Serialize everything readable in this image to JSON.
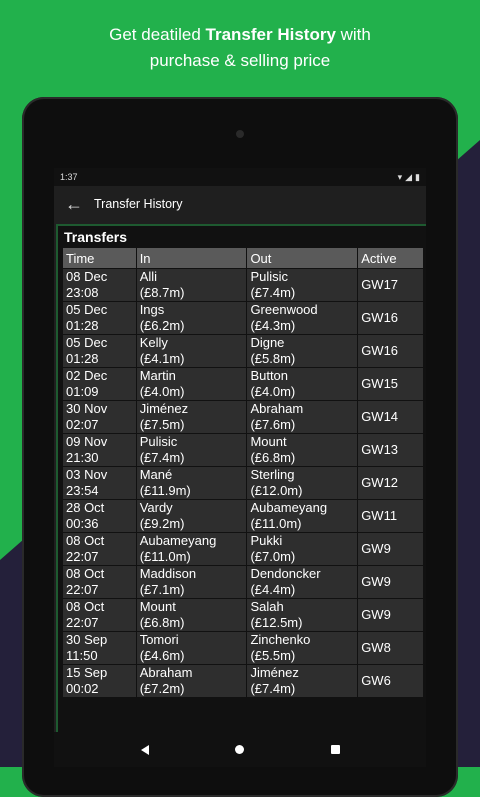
{
  "promo": {
    "line1_prefix": "Get deatiled ",
    "line1_bold": "Transfer History",
    "line1_suffix": " with",
    "line2": "purchase & selling price"
  },
  "status_bar": {
    "time": "1:37"
  },
  "app_bar": {
    "title": "Transfer History",
    "back_icon": "arrow-left-icon"
  },
  "panel": {
    "title": "Transfers",
    "columns": [
      "Time",
      "In",
      "Out",
      "Active"
    ],
    "rows": [
      {
        "date": "08 Dec",
        "time": "23:08",
        "in_name": "Alli",
        "in_price": "(£8.7m)",
        "out_name": "Pulisic",
        "out_price": "(£7.4m)",
        "active": "GW17"
      },
      {
        "date": "05 Dec",
        "time": "01:28",
        "in_name": "Ings",
        "in_price": "(£6.2m)",
        "out_name": "Greenwood",
        "out_price": "(£4.3m)",
        "active": "GW16"
      },
      {
        "date": "05 Dec",
        "time": "01:28",
        "in_name": "Kelly",
        "in_price": "(£4.1m)",
        "out_name": "Digne",
        "out_price": "(£5.8m)",
        "active": "GW16"
      },
      {
        "date": "02 Dec",
        "time": "01:09",
        "in_name": "Martin",
        "in_price": "(£4.0m)",
        "out_name": "Button",
        "out_price": "(£4.0m)",
        "active": "GW15"
      },
      {
        "date": "30 Nov",
        "time": "02:07",
        "in_name": "Jiménez",
        "in_price": "(£7.5m)",
        "out_name": "Abraham",
        "out_price": "(£7.6m)",
        "active": "GW14"
      },
      {
        "date": "09 Nov",
        "time": "21:30",
        "in_name": "Pulisic",
        "in_price": "(£7.4m)",
        "out_name": "Mount",
        "out_price": "(£6.8m)",
        "active": "GW13"
      },
      {
        "date": "03 Nov",
        "time": "23:54",
        "in_name": "Mané",
        "in_price": "(£11.9m)",
        "out_name": "Sterling",
        "out_price": "(£12.0m)",
        "active": "GW12"
      },
      {
        "date": "28 Oct",
        "time": "00:36",
        "in_name": "Vardy",
        "in_price": "(£9.2m)",
        "out_name": "Aubameyang",
        "out_price": "(£11.0m)",
        "active": "GW11"
      },
      {
        "date": "08 Oct",
        "time": "22:07",
        "in_name": "Aubameyang",
        "in_price": "(£11.0m)",
        "out_name": "Pukki",
        "out_price": "(£7.0m)",
        "active": "GW9"
      },
      {
        "date": "08 Oct",
        "time": "22:07",
        "in_name": "Maddison",
        "in_price": "(£7.1m)",
        "out_name": "Dendoncker",
        "out_price": "(£4.4m)",
        "active": "GW9"
      },
      {
        "date": "08 Oct",
        "time": "22:07",
        "in_name": "Mount",
        "in_price": "(£6.8m)",
        "out_name": "Salah",
        "out_price": "(£12.5m)",
        "active": "GW9"
      },
      {
        "date": "30 Sep",
        "time": "11:50",
        "in_name": "Tomori",
        "in_price": "(£4.6m)",
        "out_name": "Zinchenko",
        "out_price": "(£5.5m)",
        "active": "GW8"
      },
      {
        "date": "15 Sep",
        "time": "00:02",
        "in_name": "Abraham",
        "in_price": "(£7.2m)",
        "out_name": "Jiménez",
        "out_price": "(£7.4m)",
        "active": "GW6"
      }
    ]
  },
  "colors": {
    "green_bg": "#22b14c",
    "dark_bg": "#24203a",
    "panel_border": "#1e5a30",
    "header_cell": "#5a5a5a",
    "cell": "#2e2e2e"
  }
}
